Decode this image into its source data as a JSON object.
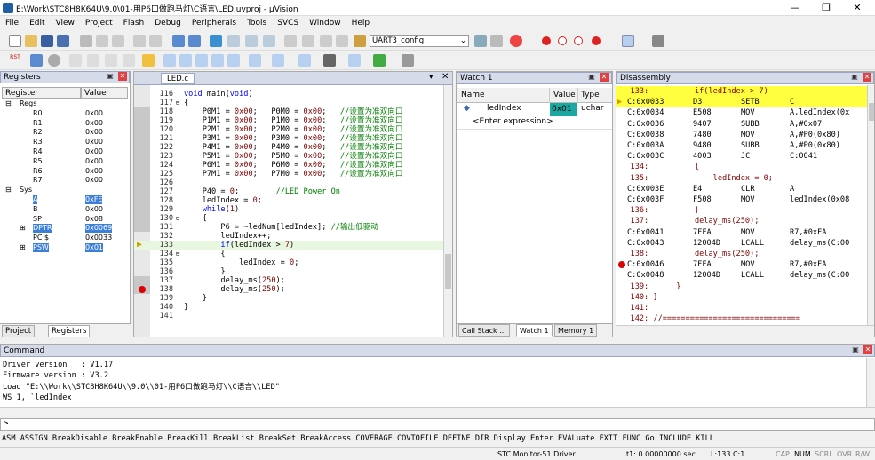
{
  "window": {
    "title": "E:\\Work\\STC8H8K64U\\9.0\\01-用P6口做跑马灯\\C语言\\LED.uvproj - µVision",
    "min": "—",
    "max": "❐",
    "close": "✕"
  },
  "menu": [
    "File",
    "Edit",
    "View",
    "Project",
    "Flash",
    "Debug",
    "Peripherals",
    "Tools",
    "SVCS",
    "Window",
    "Help"
  ],
  "toolbar": {
    "target": "UART3_config",
    "rst": "RST"
  },
  "registers": {
    "title": "Registers",
    "col_register": "Register",
    "col_value": "Value",
    "rows": [
      {
        "name": "Regs",
        "value": "",
        "indent": 0,
        "expander": "⊟"
      },
      {
        "name": "R0",
        "value": "0x00",
        "indent": 1
      },
      {
        "name": "R1",
        "value": "0x00",
        "indent": 1
      },
      {
        "name": "R2",
        "value": "0x00",
        "indent": 1
      },
      {
        "name": "R3",
        "value": "0x00",
        "indent": 1
      },
      {
        "name": "R4",
        "value": "0x00",
        "indent": 1
      },
      {
        "name": "R5",
        "value": "0x00",
        "indent": 1
      },
      {
        "name": "R6",
        "value": "0x00",
        "indent": 1
      },
      {
        "name": "R7",
        "value": "0x00",
        "indent": 1
      },
      {
        "name": "Sys",
        "value": "",
        "indent": 0,
        "expander": "⊟"
      },
      {
        "name": "A",
        "value": "0xFE",
        "indent": 1,
        "sel": true
      },
      {
        "name": "B",
        "value": "0x00",
        "indent": 1
      },
      {
        "name": "SP",
        "value": "0x08",
        "indent": 1
      },
      {
        "name": "DPTR",
        "value": "0x0069",
        "indent": 1,
        "sel": true,
        "expander": "⊞"
      },
      {
        "name": "PC $",
        "value": "0x0033",
        "indent": 1
      },
      {
        "name": "PSW",
        "value": "0x01",
        "indent": 1,
        "sel": true,
        "expander": "⊞"
      }
    ],
    "tab_project": "Project",
    "tab_registers": "Registers"
  },
  "editor": {
    "tab": "LED.c",
    "lines": [
      {
        "n": "116",
        "code": "void main(void)"
      },
      {
        "n": "117",
        "code": "{"
      },
      {
        "n": "118",
        "code": "    P0M1 = 0x00;   P0M0 = 0x00;   //设置为准双向口"
      },
      {
        "n": "119",
        "code": "    P1M1 = 0x00;   P1M0 = 0x00;   //设置为准双向口"
      },
      {
        "n": "120",
        "code": "    P2M1 = 0x00;   P2M0 = 0x00;   //设置为准双向口"
      },
      {
        "n": "121",
        "code": "    P3M1 = 0x00;   P3M0 = 0x00;   //设置为准双向口"
      },
      {
        "n": "122",
        "code": "    P4M1 = 0x00;   P4M0 = 0x00;   //设置为准双向口"
      },
      {
        "n": "123",
        "code": "    P5M1 = 0x00;   P5M0 = 0x00;   //设置为准双向口"
      },
      {
        "n": "124",
        "code": "    P6M1 = 0x00;   P6M0 = 0x00;   //设置为准双向口"
      },
      {
        "n": "125",
        "code": "    P7M1 = 0x00;   P7M0 = 0x00;   //设置为准双向口"
      },
      {
        "n": "126",
        "code": ""
      },
      {
        "n": "127",
        "code": "    P40 = 0;        //LED Power On"
      },
      {
        "n": "128",
        "code": "    ledIndex = 0;"
      },
      {
        "n": "129",
        "code": "    while(1)"
      },
      {
        "n": "130",
        "code": "    {"
      },
      {
        "n": "131",
        "code": "        P6 = ~ledNum[ledIndex]; //输出低驱动"
      },
      {
        "n": "132",
        "code": "        ledIndex++;"
      },
      {
        "n": "133",
        "code": "        if(ledIndex > 7)"
      },
      {
        "n": "134",
        "code": "        {"
      },
      {
        "n": "135",
        "code": "            ledIndex = 0;"
      },
      {
        "n": "136",
        "code": "        }"
      },
      {
        "n": "137",
        "code": "        delay_ms(250);"
      },
      {
        "n": "138",
        "code": "        delay_ms(250);"
      },
      {
        "n": "139",
        "code": "    }"
      },
      {
        "n": "140",
        "code": "}"
      },
      {
        "n": "141",
        "code": ""
      }
    ]
  },
  "watch": {
    "title": "Watch 1",
    "col_name": "Name",
    "col_value": "Value",
    "col_type": "Type",
    "var_name": "ledIndex",
    "var_value": "0x01",
    "var_type": "uchar",
    "enter": "<Enter expression>",
    "tab_callstack": "Call Stack ...",
    "tab_watch": "Watch 1",
    "tab_memory": "Memory 1"
  },
  "disasm": {
    "title": "Disassembly",
    "lines": [
      {
        "kind": "src",
        "text": "   133:          if(ledIndex > 7)",
        "hl": true
      },
      {
        "kind": "asm",
        "addr": "C:0x0033",
        "op": "D3",
        "mn": "SETB",
        "ar": "C",
        "hl": true
      },
      {
        "kind": "asm",
        "addr": "C:0x0034",
        "op": "E508",
        "mn": "MOV",
        "ar": "A,ledIndex(0x"
      },
      {
        "kind": "asm",
        "addr": "C:0x0036",
        "op": "9407",
        "mn": "SUBB",
        "ar": "A,#0x07"
      },
      {
        "kind": "asm",
        "addr": "C:0x0038",
        "op": "7480",
        "mn": "MOV",
        "ar": "A,#P0(0x80)"
      },
      {
        "kind": "asm",
        "addr": "C:0x003A",
        "op": "9480",
        "mn": "SUBB",
        "ar": "A,#P0(0x80)"
      },
      {
        "kind": "asm",
        "addr": "C:0x003C",
        "op": "4003",
        "mn": "JC",
        "ar": "C:0041"
      },
      {
        "kind": "src",
        "text": "   134:          {"
      },
      {
        "kind": "src",
        "text": "   135:              ledIndex = 0;"
      },
      {
        "kind": "asm",
        "addr": "C:0x003E",
        "op": "E4",
        "mn": "CLR",
        "ar": "A"
      },
      {
        "kind": "asm",
        "addr": "C:0x003F",
        "op": "F508",
        "mn": "MOV",
        "ar": "ledIndex(0x08"
      },
      {
        "kind": "src",
        "text": "   136:          }"
      },
      {
        "kind": "src",
        "text": "   137:          delay_ms(250);"
      },
      {
        "kind": "asm",
        "addr": "C:0x0041",
        "op": "7FFA",
        "mn": "MOV",
        "ar": "R7,#0xFA"
      },
      {
        "kind": "asm",
        "addr": "C:0x0043",
        "op": "12004D",
        "mn": "LCALL",
        "ar": "delay_ms(C:00"
      },
      {
        "kind": "src",
        "text": "   138:          delay_ms(250);"
      },
      {
        "kind": "asm",
        "addr": "C:0x0046",
        "op": "7FFA",
        "mn": "MOV",
        "ar": "R7,#0xFA"
      },
      {
        "kind": "asm",
        "addr": "C:0x0048",
        "op": "12004D",
        "mn": "LCALL",
        "ar": "delay_ms(C:00"
      },
      {
        "kind": "src",
        "text": "   139:      }"
      },
      {
        "kind": "src",
        "text": "   140: }"
      },
      {
        "kind": "src",
        "text": "   141:"
      },
      {
        "kind": "src",
        "text": "   142: //=============================="
      }
    ]
  },
  "command": {
    "title": "Command",
    "lines": [
      "Driver version   : V1.17",
      "Firmware version : V3.2",
      "Load \"E:\\\\Work\\\\STC8H8K64U\\\\9.0\\\\01-用P6口做跑马灯\\\\C语言\\\\LED\"",
      "WS 1, `ledIndex"
    ],
    "prompt": ">",
    "keywords": "ASM ASSIGN BreakDisable BreakEnable BreakKill BreakList BreakSet BreakAccess COVERAGE COVTOFILE DEFINE DIR Display Enter EVALuate EXIT FUNC Go INCLUDE KILL"
  },
  "status": {
    "driver": "STC Monitor-51 Driver",
    "time": "t1: 0.00000000 sec",
    "pos": "L:133 C:1",
    "caps": "CAP",
    "num": "NUM",
    "scrl": "SCRL",
    "ovr": "OVR",
    "rw": "R/W"
  }
}
